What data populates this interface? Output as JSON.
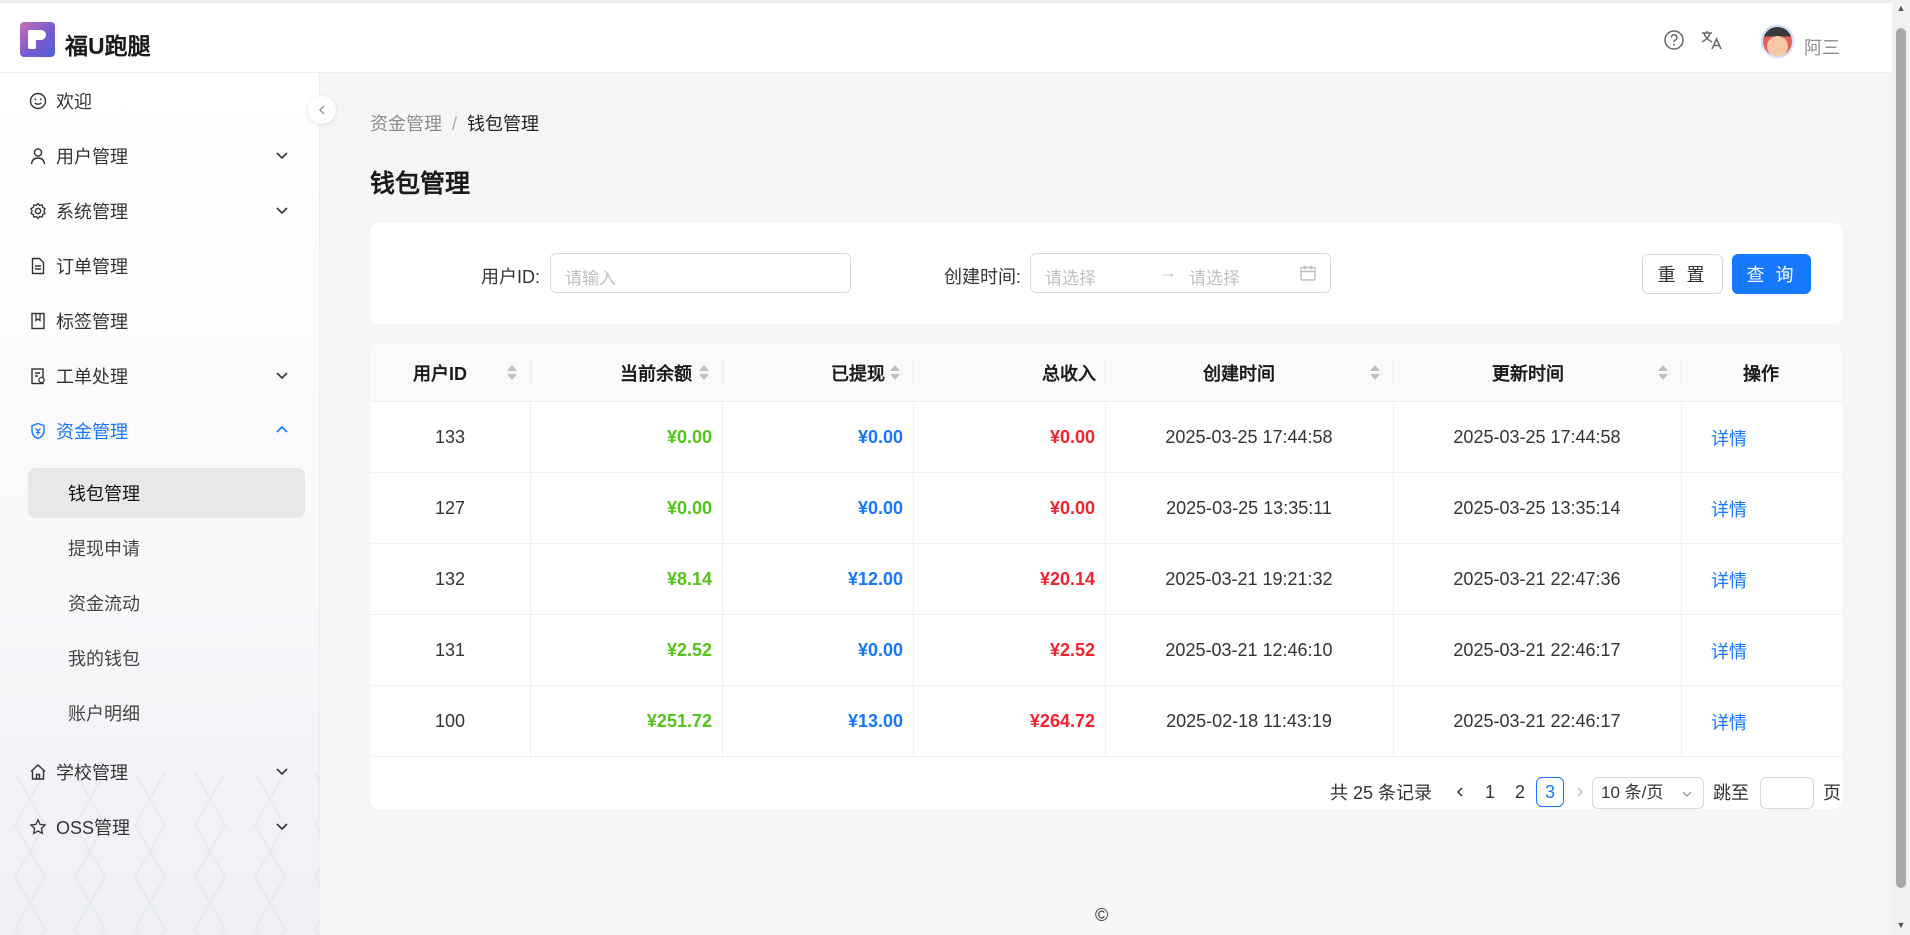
{
  "app": {
    "title": "福U跑腿",
    "user_name": "阿三",
    "help_icon": "help-circle-icon",
    "translate_icon": "translate-icon"
  },
  "sidebar": {
    "items": [
      {
        "label": "欢迎",
        "icon": "smile-icon"
      },
      {
        "label": "用户管理",
        "icon": "user-icon"
      },
      {
        "label": "系统管理",
        "icon": "gear-icon"
      },
      {
        "label": "订单管理",
        "icon": "file-icon"
      },
      {
        "label": "标签管理",
        "icon": "book-icon"
      },
      {
        "label": "工单处理",
        "icon": "clipboard-icon"
      },
      {
        "label": "资金管理",
        "icon": "shield-icon"
      },
      {
        "label": "学校管理",
        "icon": "home-icon"
      },
      {
        "label": "OSS管理",
        "icon": "star-icon"
      }
    ],
    "submenu": [
      {
        "label": "钱包管理",
        "selected": true
      },
      {
        "label": "提现申请"
      },
      {
        "label": "资金流动"
      },
      {
        "label": "我的钱包"
      },
      {
        "label": "账户明细"
      }
    ]
  },
  "breadcrumb": {
    "parent": "资金管理",
    "separator": "/",
    "current": "钱包管理"
  },
  "page": {
    "title": "钱包管理"
  },
  "filters": {
    "user_id_label": "用户ID:",
    "user_id_placeholder": "请输入",
    "created_label": "创建时间:",
    "start_placeholder": "请选择",
    "end_placeholder": "请选择",
    "reset_label": "重 置",
    "query_label": "查 询"
  },
  "table": {
    "columns": [
      "用户ID",
      "当前余额",
      "已提现",
      "总收入",
      "创建时间",
      "更新时间",
      "操作"
    ],
    "rows": [
      {
        "id": "133",
        "balance": "¥0.00",
        "withdrawn": "¥0.00",
        "income": "¥0.00",
        "created": "2025-03-25 17:44:58",
        "updated": "2025-03-25 17:44:58",
        "action": "详情"
      },
      {
        "id": "127",
        "balance": "¥0.00",
        "withdrawn": "¥0.00",
        "income": "¥0.00",
        "created": "2025-03-25 13:35:11",
        "updated": "2025-03-25 13:35:14",
        "action": "详情"
      },
      {
        "id": "132",
        "balance": "¥8.14",
        "withdrawn": "¥12.00",
        "income": "¥20.14",
        "created": "2025-03-21 19:21:32",
        "updated": "2025-03-21 22:47:36",
        "action": "详情"
      },
      {
        "id": "131",
        "balance": "¥2.52",
        "withdrawn": "¥0.00",
        "income": "¥2.52",
        "created": "2025-03-21 12:46:10",
        "updated": "2025-03-21 22:46:17",
        "action": "详情"
      },
      {
        "id": "100",
        "balance": "¥251.72",
        "withdrawn": "¥13.00",
        "income": "¥264.72",
        "created": "2025-02-18 11:43:19",
        "updated": "2025-03-21 22:46:17",
        "action": "详情"
      }
    ]
  },
  "pagination": {
    "total_text": "共 25 条记录",
    "pages": [
      "1",
      "2",
      "3"
    ],
    "current_page": "3",
    "page_size": "10 条/页",
    "jump_label": "跳至",
    "page_suffix": "页"
  },
  "footer": {
    "copyright": "©"
  },
  "colors": {
    "primary": "#1677ff",
    "balance": "#52c41a",
    "withdrawn": "#1677ff",
    "income": "#f5222d"
  }
}
